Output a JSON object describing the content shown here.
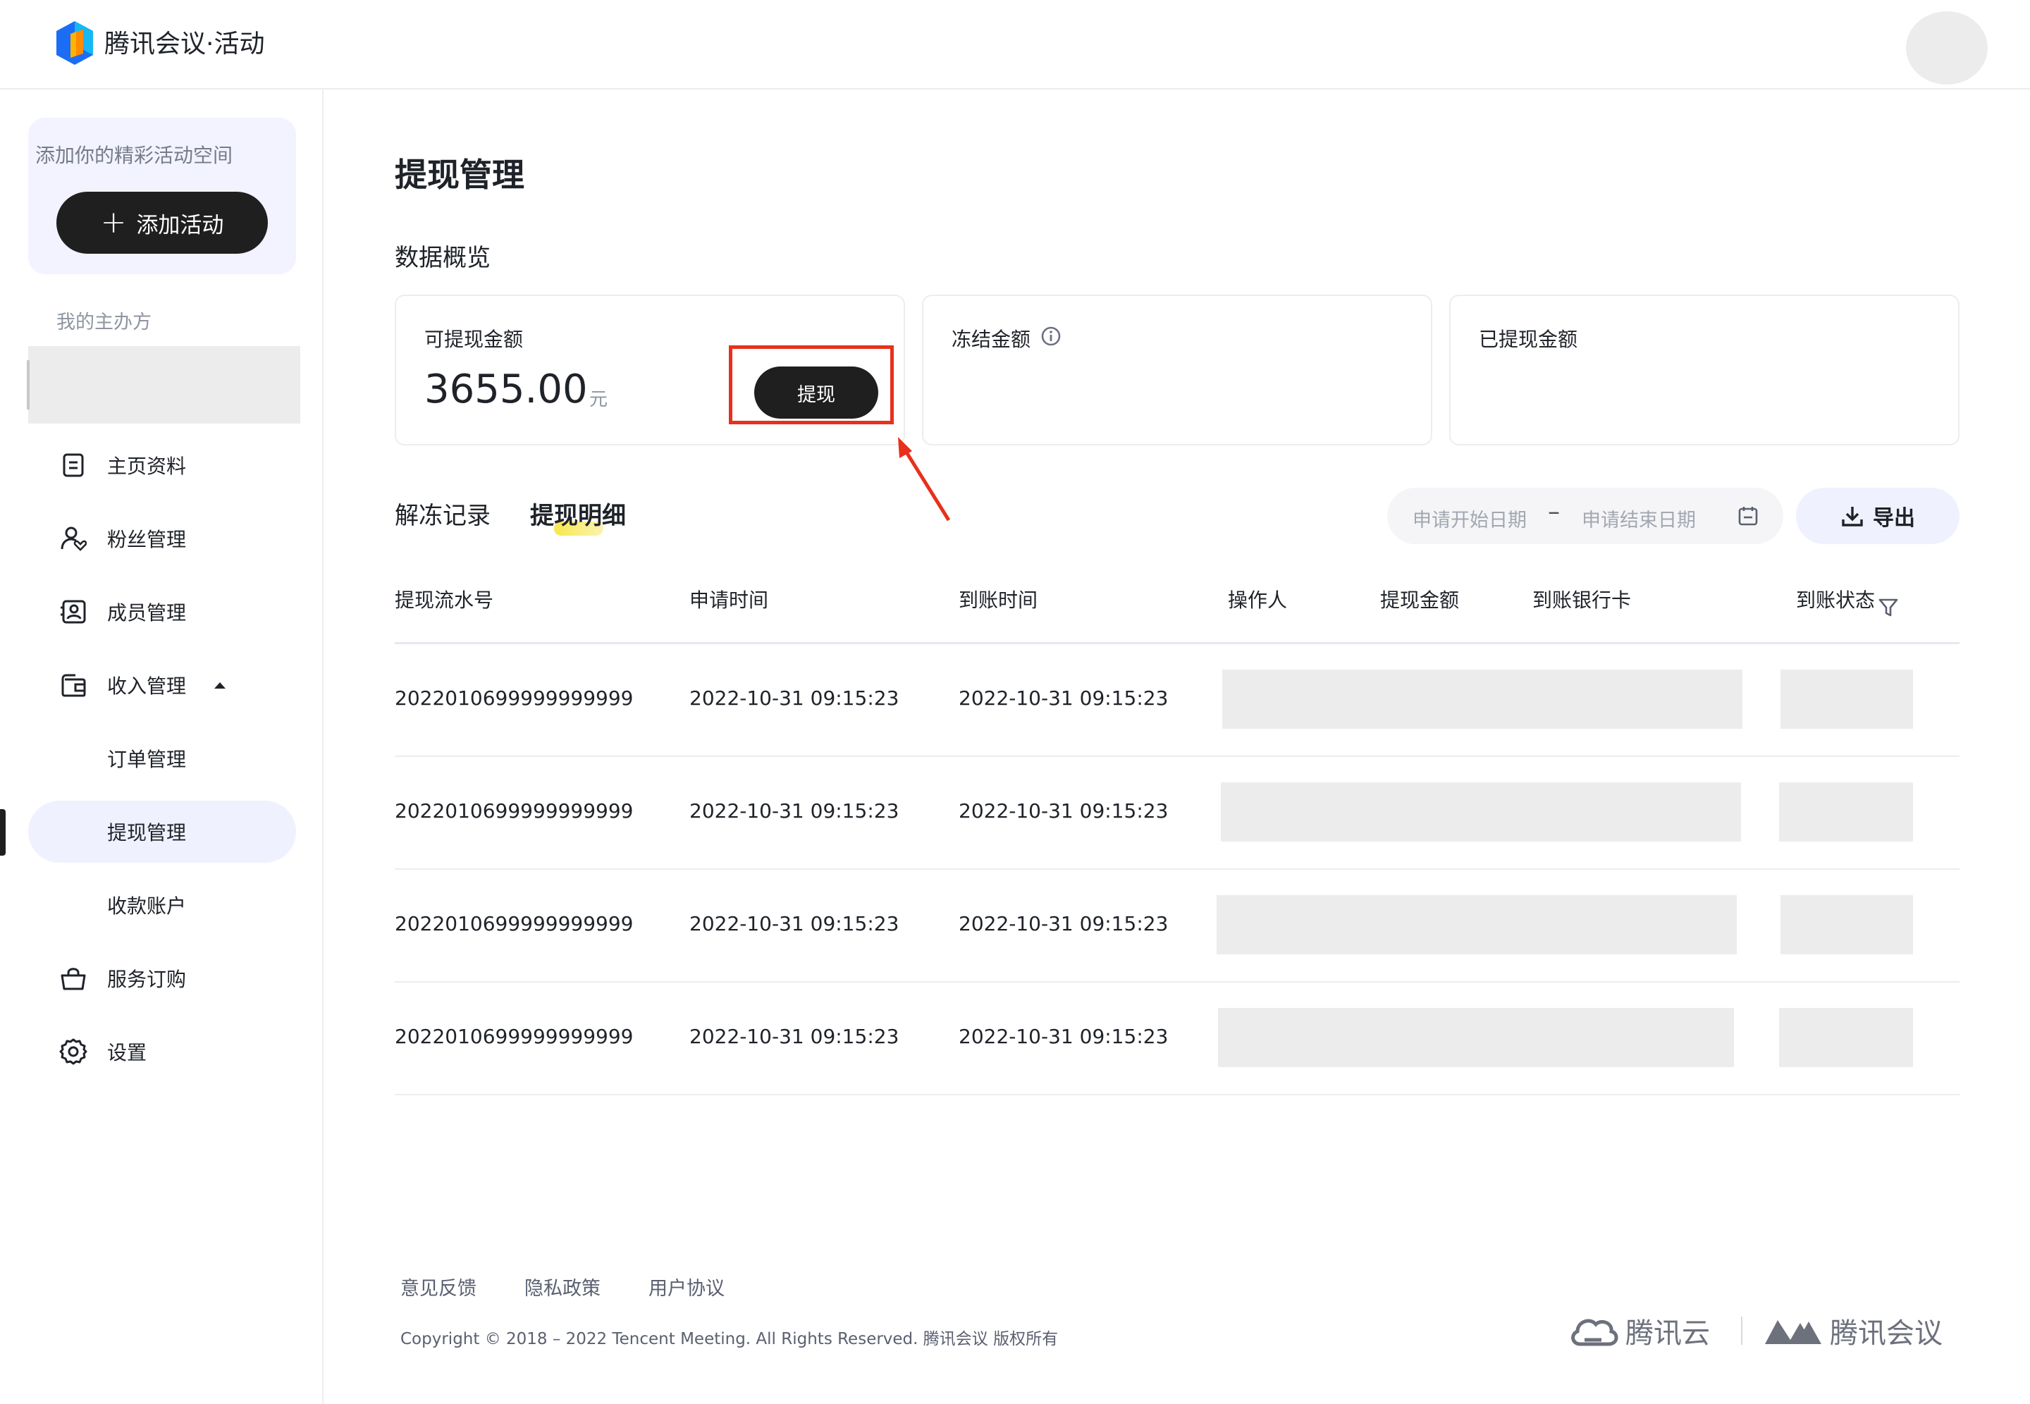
{
  "header": {
    "brand": "腾讯会议·活动"
  },
  "sidebar": {
    "promo_text": "添加你的精彩活动空间",
    "add_button": "添加活动",
    "org_label": "我的主办方",
    "items": [
      {
        "label": "主页资料",
        "icon": "document-icon"
      },
      {
        "label": "粉丝管理",
        "icon": "user-heart-icon"
      },
      {
        "label": "成员管理",
        "icon": "member-card-icon"
      },
      {
        "label": "收入管理",
        "icon": "wallet-icon",
        "expanded": true
      },
      {
        "label": "订单管理",
        "sub": true
      },
      {
        "label": "提现管理",
        "sub": true,
        "active": true
      },
      {
        "label": "收款账户",
        "sub": true
      },
      {
        "label": "服务订购",
        "icon": "shopping-bag-icon"
      },
      {
        "label": "设置",
        "icon": "gear-icon"
      }
    ]
  },
  "main": {
    "title": "提现管理",
    "overview_label": "数据概览",
    "cards": {
      "available": {
        "label": "可提现金额",
        "amount": "3655.00",
        "unit": "元",
        "button": "提现"
      },
      "frozen": {
        "label": "冻结金额"
      },
      "withdrawn": {
        "label": "已提现金额"
      }
    },
    "tabs": [
      {
        "label": "解冻记录"
      },
      {
        "label": "提现明细",
        "active": true
      }
    ],
    "date_range": {
      "start_placeholder": "申请开始日期",
      "separator": "–",
      "end_placeholder": "申请结束日期"
    },
    "export_button": "导出",
    "table": {
      "columns": [
        "提现流水号",
        "申请时间",
        "到账时间",
        "操作人",
        "提现金额",
        "到账银行卡",
        "到账状态"
      ],
      "rows": [
        {
          "serial": "2022010699999999999",
          "apply_time": "2022-10-31 09:15:23",
          "arrival_time": "2022-10-31 09:15:23"
        },
        {
          "serial": "2022010699999999999",
          "apply_time": "2022-10-31 09:15:23",
          "arrival_time": "2022-10-31 09:15:23"
        },
        {
          "serial": "2022010699999999999",
          "apply_time": "2022-10-31 09:15:23",
          "arrival_time": "2022-10-31 09:15:23"
        },
        {
          "serial": "2022010699999999999",
          "apply_time": "2022-10-31 09:15:23",
          "arrival_time": "2022-10-31 09:15:23"
        }
      ]
    }
  },
  "footer": {
    "links": [
      "意见反馈",
      "隐私政策",
      "用户协议"
    ],
    "copyright": "Copyright © 2018 – 2022  Tencent Meeting. All Rights Reserved. 腾讯会议 版权所有",
    "logo_cloud": "腾讯云",
    "logo_meeting": "腾讯会议"
  },
  "colors": {
    "accent_dark": "#1f1f1f",
    "highlight_red": "#e8301c",
    "active_nav_bg": "#f0f1ff"
  }
}
